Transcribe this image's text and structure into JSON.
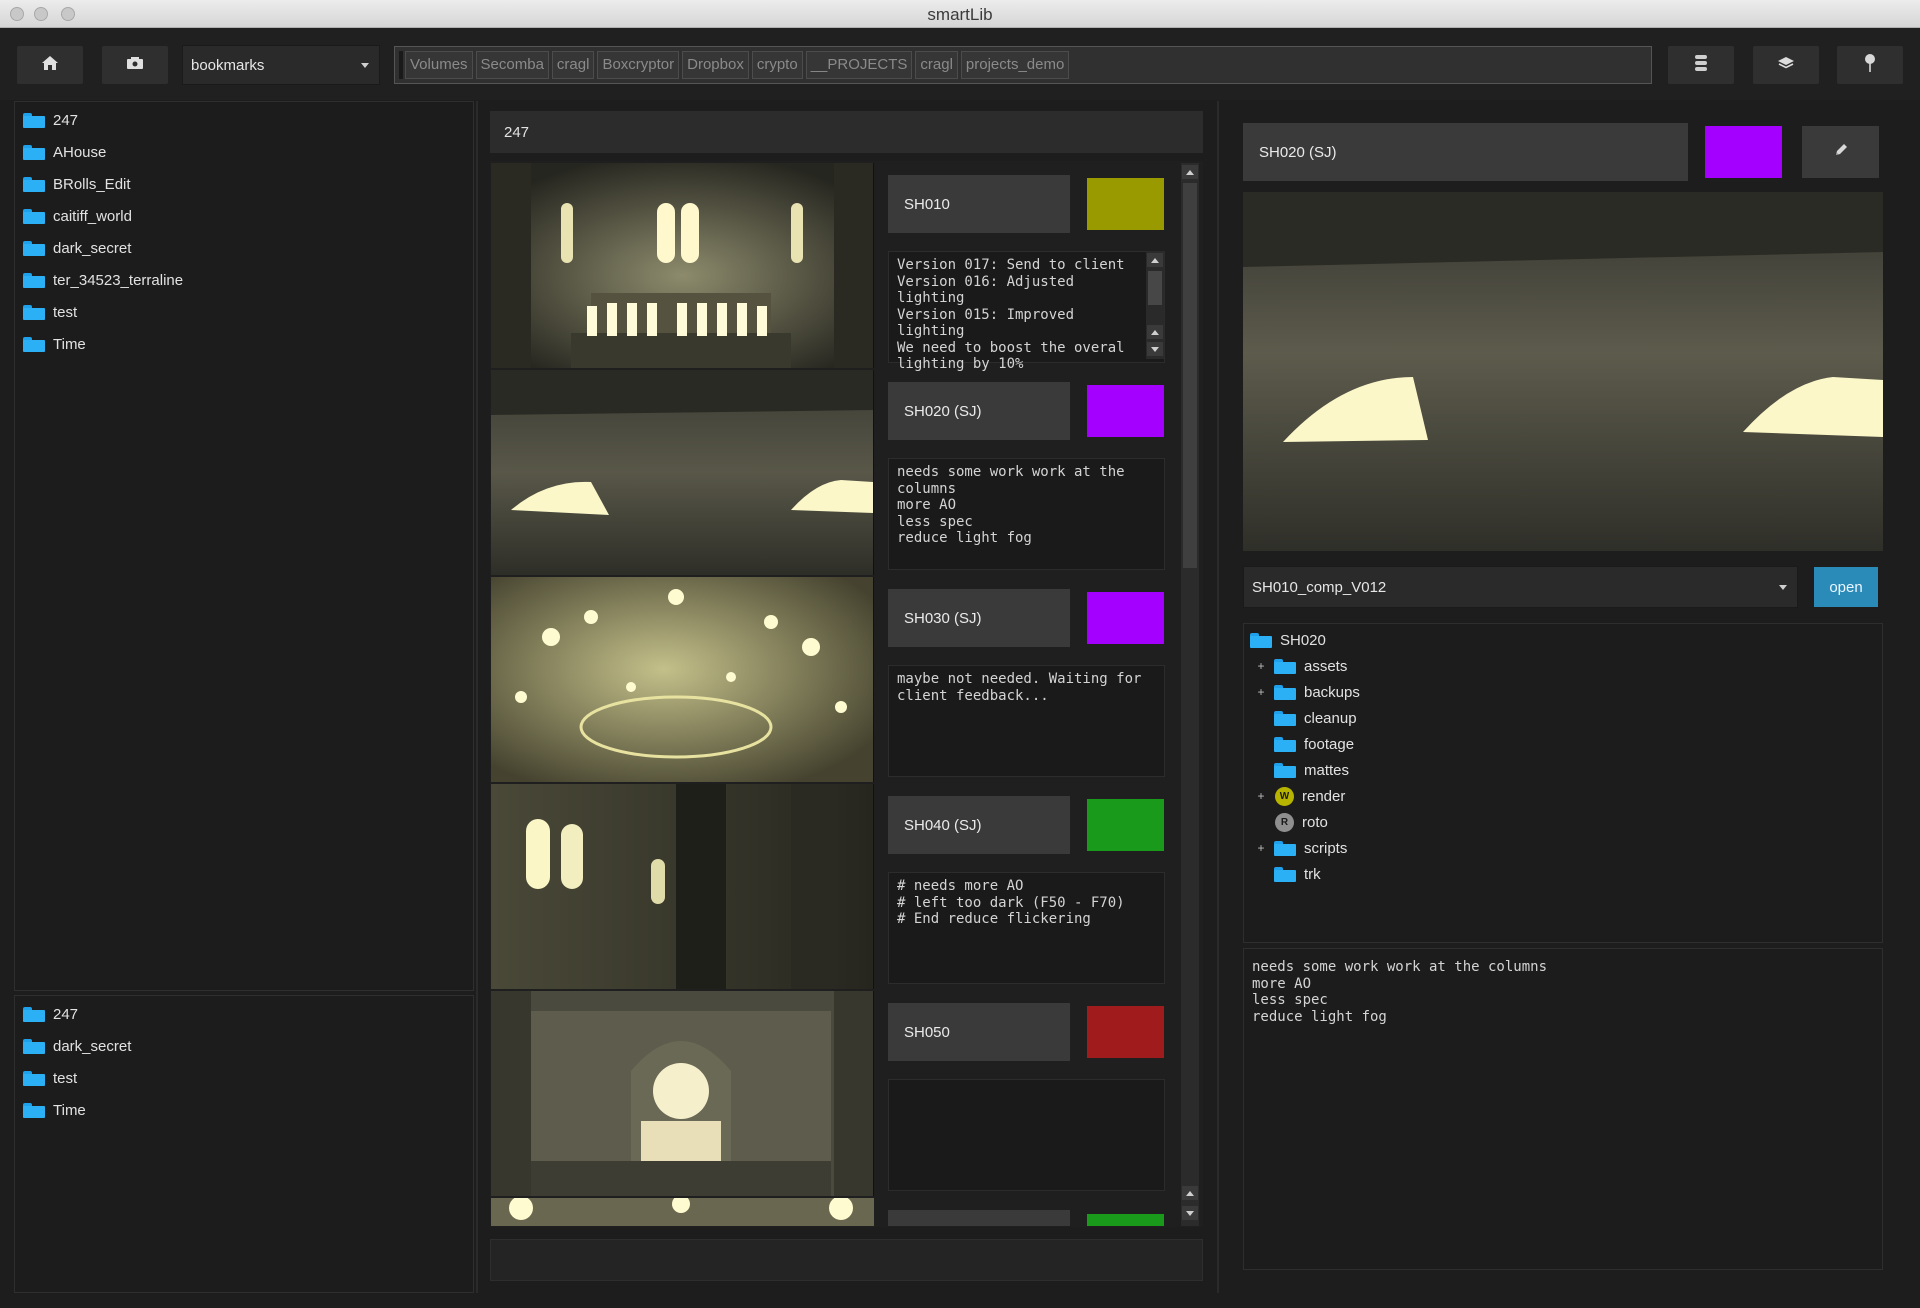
{
  "window": {
    "title": "smartLib"
  },
  "toolbar": {
    "home_icon": "home-icon",
    "drive_icon": "drive-icon",
    "bookmarks_label": "bookmarks",
    "path_crumbs": [
      "Volumes",
      "Secomba",
      "cragl",
      "Boxcryptor",
      "Dropbox",
      "crypto",
      "__PROJECTS",
      "cragl",
      "projects_demo"
    ],
    "right_icons": [
      "database-icon",
      "layers-icon",
      "pin-icon"
    ]
  },
  "sidebar": {
    "top_items": [
      "247",
      "AHouse",
      "BRolls_Edit",
      "caitiff_world",
      "dark_secret",
      "ter_34523_terraline",
      "test",
      "Time"
    ],
    "bottom_items": [
      "247",
      "dark_secret",
      "test",
      "Time"
    ]
  },
  "center": {
    "header": "247",
    "shots": [
      {
        "name": "SH010",
        "color": "#999900",
        "notes": "Version 017: Send to client\nVersion 016: Adjusted lighting\nVersion 015: Improved lighting\nWe need to boost the overal\nlighting by 10%"
      },
      {
        "name": "SH020 (SJ)",
        "color": "#a300ff",
        "notes": "needs some work work at the\ncolumns\nmore AO\nless spec\nreduce light fog"
      },
      {
        "name": "SH030 (SJ)",
        "color": "#a300ff",
        "notes": "maybe not needed. Waiting for\nclient feedback..."
      },
      {
        "name": "SH040 (SJ)",
        "color": "#1a9a1a",
        "notes": "# needs more AO\n# left too dark (F50 - F70)\n# End reduce flickering"
      },
      {
        "name": "SH050",
        "color": "#a01c1c",
        "notes": ""
      }
    ],
    "partial_shot_color": "#1a9a1a"
  },
  "detail": {
    "shot_name": "SH020 (SJ)",
    "shot_color": "#a300ff",
    "edit_icon": "pencil-icon",
    "version_select": "SH010_comp_V012",
    "open_label": "open",
    "tree_root": "SH020",
    "tree": [
      {
        "label": "assets",
        "expandable": true,
        "icon": "folder-icon"
      },
      {
        "label": "backups",
        "expandable": true,
        "icon": "folder-icon"
      },
      {
        "label": "cleanup",
        "expandable": false,
        "icon": "folder-icon"
      },
      {
        "label": "footage",
        "expandable": false,
        "icon": "folder-icon"
      },
      {
        "label": "mattes",
        "expandable": false,
        "icon": "folder-icon"
      },
      {
        "label": "render",
        "expandable": true,
        "icon": "badge-w-icon",
        "badge": "W",
        "badge_color": "#b7b400"
      },
      {
        "label": "roto",
        "expandable": false,
        "icon": "badge-r-icon",
        "badge": "R",
        "badge_color": "#8f8f8f"
      },
      {
        "label": "scripts",
        "expandable": true,
        "icon": "folder-icon"
      },
      {
        "label": "trk",
        "expandable": false,
        "icon": "folder-icon"
      }
    ],
    "notes": "needs some work work at the columns\nmore AO\nless spec\nreduce light fog"
  }
}
